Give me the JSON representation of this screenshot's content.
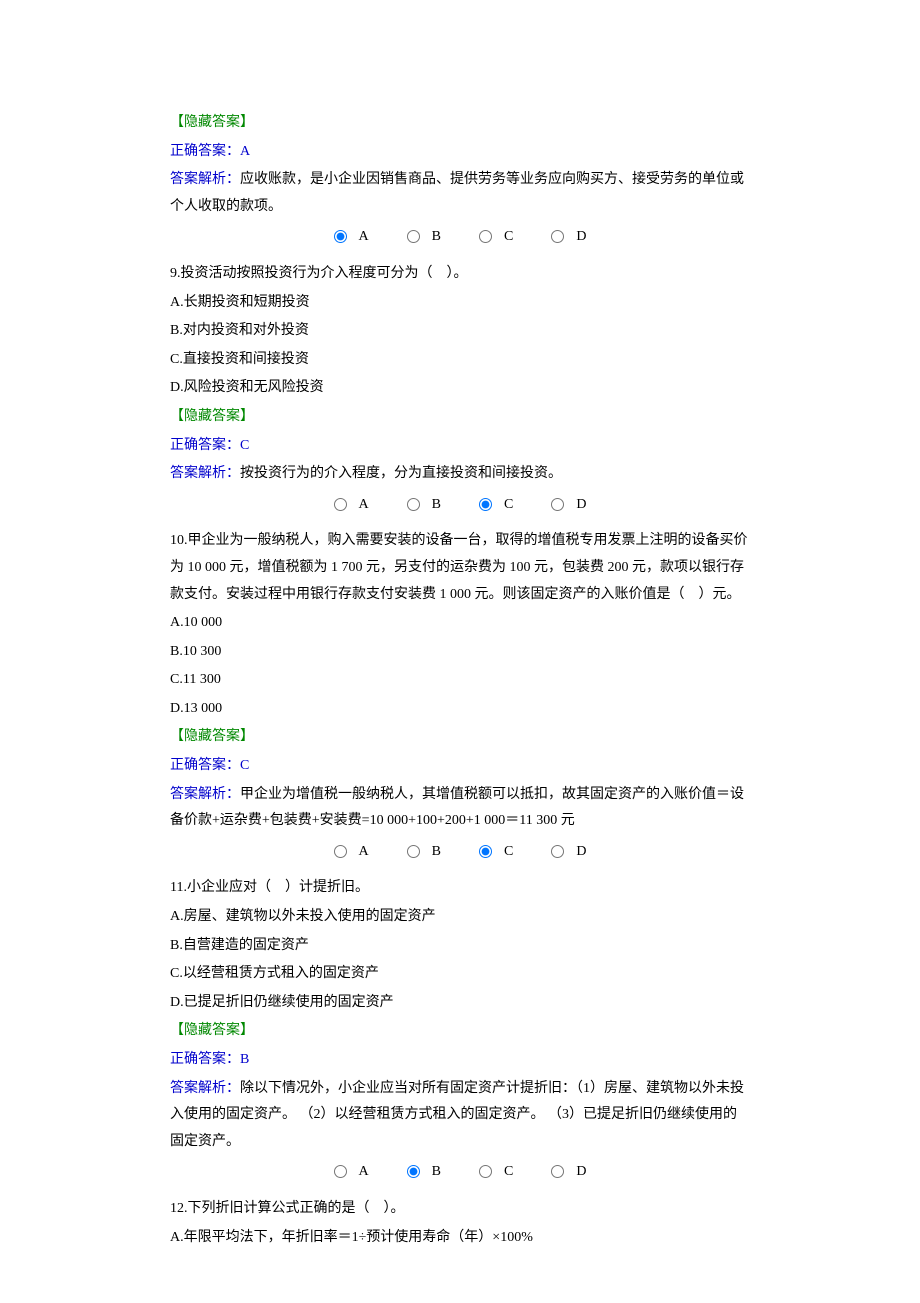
{
  "labels": {
    "hide_answer": "【隐藏答案】",
    "correct_prefix": "正确答案：",
    "analysis_prefix": "答案解析：",
    "radio_A": "A",
    "radio_B": "B",
    "radio_C": "C",
    "radio_D": "D"
  },
  "q8": {
    "correct": "A",
    "analysis": "应收账款，是小企业因销售商品、提供劳务等业务应向购买方、接受劳务的单位或个人收取的款项。",
    "selected": "A"
  },
  "q9": {
    "stem": "9.投资活动按照投资行为介入程度可分为（　）。",
    "A": "A.长期投资和短期投资",
    "B": "B.对内投资和对外投资",
    "C": "C.直接投资和间接投资",
    "D": "D.风险投资和无风险投资",
    "correct": "C",
    "analysis": "按投资行为的介入程度，分为直接投资和间接投资。",
    "selected": "C"
  },
  "q10": {
    "stem": "10.甲企业为一般纳税人，购入需要安装的设备一台，取得的增值税专用发票上注明的设备买价为 10 000 元，增值税额为 1 700 元，另支付的运杂费为 100 元，包装费 200 元，款项以银行存款支付。安装过程中用银行存款支付安装费 1 000 元。则该固定资产的入账价值是（　）元。",
    "A": "A.10 000",
    "B": "B.10 300",
    "C": "C.11 300",
    "D": "D.13 000",
    "correct": "C",
    "analysis": "甲企业为增值税一般纳税人，其增值税额可以抵扣，故其固定资产的入账价值＝设备价款+运杂费+包装费+安装费=10 000+100+200+1 000＝11 300 元",
    "selected": "C"
  },
  "q11": {
    "stem": "11.小企业应对（　）计提折旧。",
    "A": "A.房屋、建筑物以外未投入使用的固定资产",
    "B": "B.自营建造的固定资产",
    "C": "C.以经营租赁方式租入的固定资产",
    "D": "D.已提足折旧仍继续使用的固定资产",
    "correct": "B",
    "analysis": "除以下情况外，小企业应当对所有固定资产计提折旧：（1）房屋、建筑物以外未投入使用的固定资产。 （2）以经营租赁方式租入的固定资产。 （3）已提足折旧仍继续使用的固定资产。",
    "selected": "B"
  },
  "q12": {
    "stem": "12.下列折旧计算公式正确的是（　）。",
    "A": "A.年限平均法下，年折旧率＝1÷预计使用寿命（年）×100%"
  }
}
